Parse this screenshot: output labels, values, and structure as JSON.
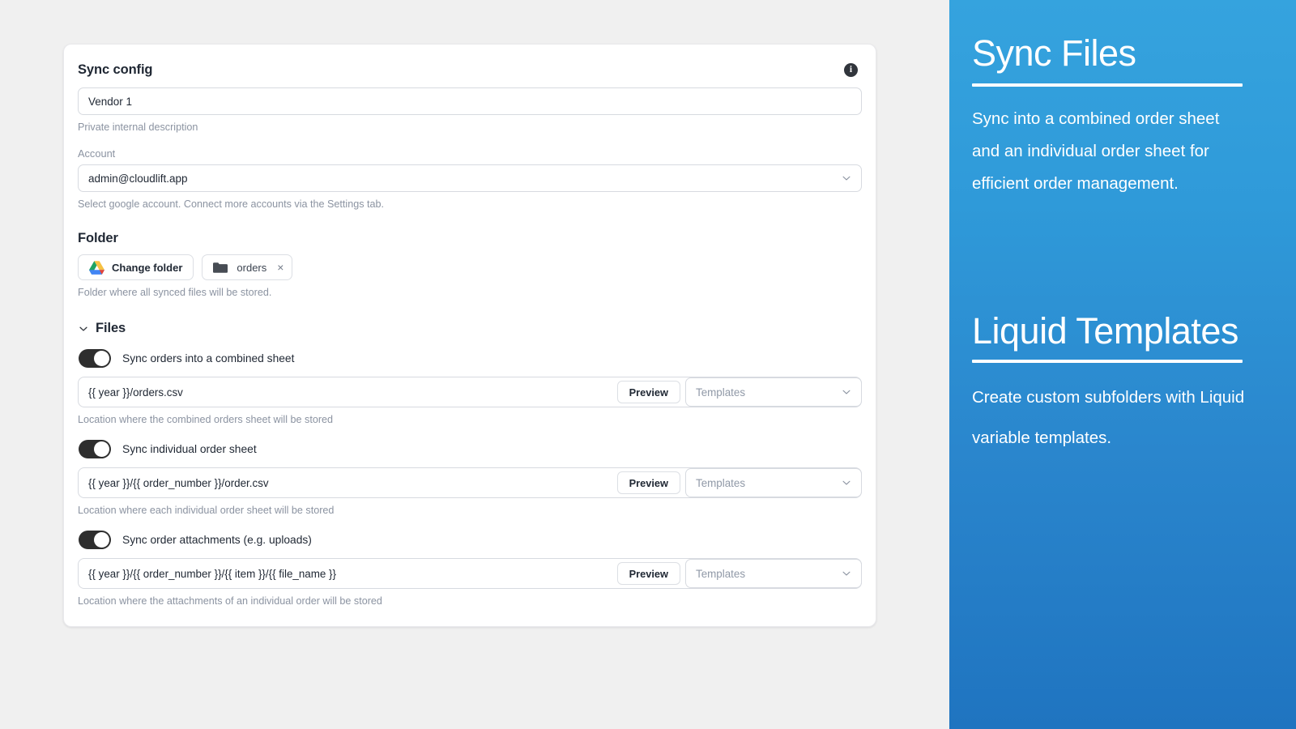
{
  "card": {
    "title": "Sync config",
    "info_icon": "info-circle-icon",
    "name_field": {
      "value": "Vendor 1",
      "placeholder": "Vendor 1",
      "helper": "Private internal description"
    },
    "account": {
      "label": "Account",
      "value": "admin@cloudlift.app",
      "helper": "Select google account. Connect more accounts via the Settings tab.",
      "chevron": "chevron-down-icon"
    },
    "folder": {
      "title": "Folder",
      "change_button": "Change folder",
      "drive_icon": "google-drive-icon",
      "chip_icon": "folder-icon",
      "chip_label": "orders",
      "chip_close": "×",
      "helper": "Folder where all synced files will be stored."
    },
    "files_section": {
      "title": "Files",
      "chevron": "chevron-down-icon",
      "rows": [
        {
          "toggle_label": "Sync orders into a combined sheet",
          "toggle_on": true,
          "path_value": "{{ year }}/orders.csv",
          "preview_label": "Preview",
          "templates_placeholder": "Templates",
          "helper": "Location where the combined orders sheet will be stored"
        },
        {
          "toggle_label": "Sync individual order sheet",
          "toggle_on": true,
          "path_value": "{{ year }}/{{ order_number }}/order.csv",
          "preview_label": "Preview",
          "templates_placeholder": "Templates",
          "helper": "Location where each individual order sheet will be stored"
        },
        {
          "toggle_label": "Sync order attachments (e.g. uploads)",
          "toggle_on": true,
          "path_value": "{{ year }}/{{ order_number }}/{{ item }}/{{ file_name }}",
          "preview_label": "Preview",
          "templates_placeholder": "Templates",
          "helper": "Location where the attachments of an individual order will be stored"
        }
      ]
    }
  },
  "right_panel": {
    "blocks": [
      {
        "title": "Sync Files",
        "body": "Sync into a combined order sheet and an individual order sheet for efficient order management."
      },
      {
        "title": "Liquid Templates",
        "body": "Create custom subfolders with Liquid variable templates."
      }
    ]
  },
  "colors": {
    "page_background": "#f0f0f0",
    "card_background": "#ffffff",
    "panel_gradient_top": "#35a3de",
    "panel_gradient_bottom": "#1f74c0",
    "toggle_on": "#2e2e2e",
    "text_primary": "#1f2733",
    "text_muted": "#8b93a1"
  }
}
